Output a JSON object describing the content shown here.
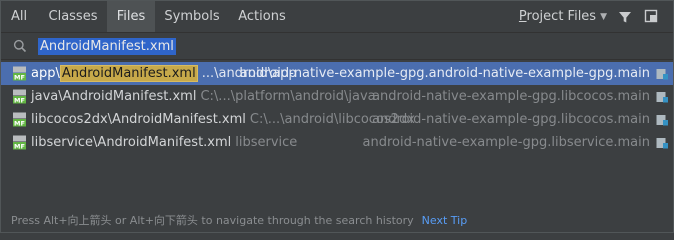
{
  "tabs": [
    {
      "label": "All",
      "active": false
    },
    {
      "label": "Classes",
      "active": false
    },
    {
      "label": "Files",
      "active": true
    },
    {
      "label": "Symbols",
      "active": false
    },
    {
      "label": "Actions",
      "active": false
    }
  ],
  "scope": {
    "label_accel": "P",
    "label_rest": "roject Files",
    "chevron": "chevron-down-icon"
  },
  "toolbar": {
    "filter_icon": "filter-icon",
    "pin_icon": "pin-window-icon"
  },
  "search": {
    "value": "AndroidManifest.xml",
    "icon": "search-icon"
  },
  "results": [
    {
      "prefix": "app\\",
      "highlight": "AndroidManifest.xml",
      "name": "",
      "path": "...\\android\\app",
      "module": "android-native-example-gpg.android-native-example-gpg.main",
      "selected": true
    },
    {
      "prefix": "",
      "highlight": "",
      "name": "java\\AndroidManifest.xml",
      "path": "C:\\...\\platform\\android\\java",
      "module": "android-native-example-gpg.libcocos.main",
      "selected": false
    },
    {
      "prefix": "",
      "highlight": "",
      "name": "libcocos2dx\\AndroidManifest.xml",
      "path": "C:\\...\\android\\libcocos2dx",
      "module": "android-native-example-gpg.libcocos.main",
      "selected": false
    },
    {
      "prefix": "",
      "highlight": "",
      "name": "libservice\\AndroidManifest.xml",
      "path": "libservice",
      "module": "android-native-example-gpg.libservice.main",
      "selected": false
    }
  ],
  "footer": {
    "hint": "Press Alt+向上箭头 or Alt+向下箭头 to navigate through the search history",
    "next_tip": "Next Tip"
  },
  "colors": {
    "background": "#3c3f41",
    "selection": "#4b6eaf",
    "match_highlight": "#c7a94a",
    "link": "#589df6",
    "mf_icon_green": "#62b543"
  }
}
